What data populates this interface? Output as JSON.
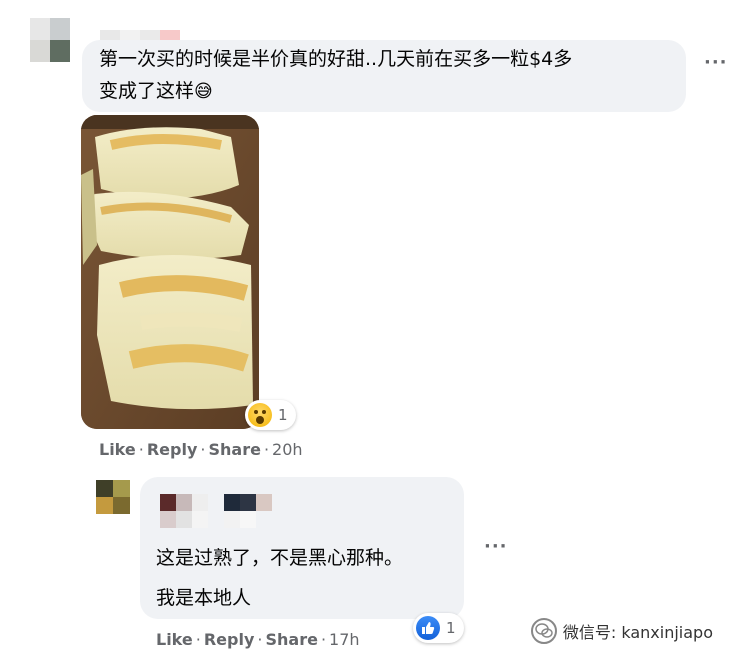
{
  "comment1": {
    "text_line1": "第一次买的时候是半价真的好甜..几天前在买多一粒$4多",
    "text_line2": "变成了这样",
    "emoji": "😅",
    "more_label": "···",
    "photo_alt": "",
    "reaction": {
      "icon": "wow-emoji-icon",
      "count": "1"
    },
    "actions": {
      "like": "Like",
      "reply": "Reply",
      "share": "Share",
      "time": "20h",
      "sep": "·"
    }
  },
  "reply1": {
    "text_line1": "这是过熟了，不是黑心那种。",
    "text_line2": "我是本地人",
    "more_label": "···",
    "reaction": {
      "icon": "thumbs-up-icon",
      "count": "1"
    },
    "actions": {
      "like": "Like",
      "reply": "Reply",
      "share": "Share",
      "time": "17h",
      "sep": "·"
    }
  },
  "watermark": {
    "label": "微信号: kanxinjiapo",
    "icon": "wechat-icon"
  },
  "colors": {
    "bubble": "#f0f2f5",
    "meta_text": "#65676b",
    "like_blue": "#1877f2"
  }
}
